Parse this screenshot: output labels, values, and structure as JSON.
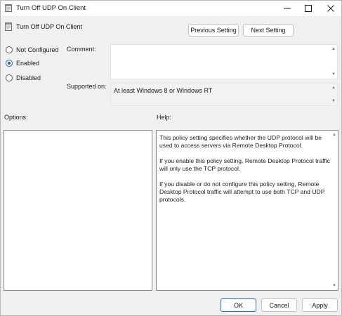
{
  "window": {
    "title": "Turn Off UDP On Client"
  },
  "header": {
    "title": "Turn Off UDP On Client",
    "previous_label": "Previous Setting",
    "next_label": "Next Setting"
  },
  "state": {
    "options": [
      "Not Configured",
      "Enabled",
      "Disabled"
    ],
    "selected": "Enabled"
  },
  "fields": {
    "comment_label": "Comment:",
    "comment_value": "",
    "supported_label": "Supported on:",
    "supported_value": "At least Windows 8 or Windows RT"
  },
  "panes": {
    "options_label": "Options:",
    "help_label": "Help:",
    "help_paragraphs": [
      "This policy setting specifies whether the UDP protocol will be used to access servers via Remote Desktop Protocol.",
      "If you enable this policy setting, Remote Desktop Protocol traffic will only use the TCP protocol.",
      "If you disable or do not configure this policy setting, Remote Desktop Protocol traffic will attempt to use both TCP and UDP protocols."
    ]
  },
  "footer": {
    "ok_label": "OK",
    "cancel_label": "Cancel",
    "apply_label": "Apply"
  },
  "colors": {
    "accent": "#1f5fae",
    "window_bg": "#f0f0f0"
  }
}
